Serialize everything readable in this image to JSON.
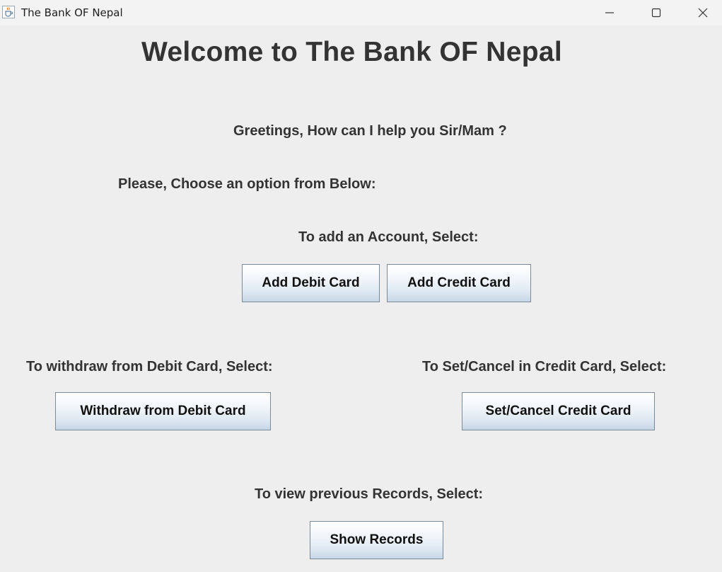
{
  "window": {
    "title": "The Bank OF Nepal"
  },
  "main": {
    "heading": "Welcome to The Bank OF Nepal",
    "greeting": "Greetings, How can I help you Sir/Mam ?",
    "instruction": "Please, Choose an option from Below:",
    "add_account_label": "To add an Account, Select:",
    "add_debit_button": "Add Debit Card",
    "add_credit_button": "Add Credit Card",
    "withdraw_label": "To withdraw from Debit Card, Select:",
    "withdraw_button": "Withdraw from Debit Card",
    "set_cancel_label": "To Set/Cancel in Credit Card, Select:",
    "set_cancel_button": "Set/Cancel Credit Card",
    "records_label": "To view previous Records, Select:",
    "records_button": "Show Records"
  },
  "icons": {
    "app": "java-cup-icon",
    "minimize": "minimize-icon",
    "maximize": "maximize-icon",
    "close": "close-icon"
  }
}
